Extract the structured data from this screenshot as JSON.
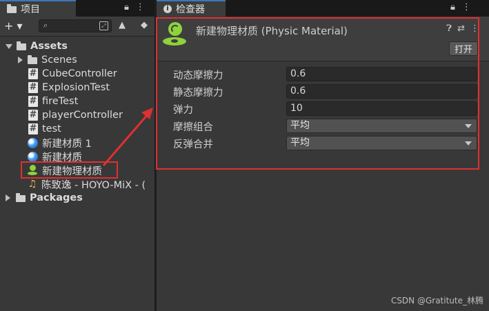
{
  "project_panel": {
    "tab_label": "项目",
    "toolbar": {
      "add_label": "+ ▾",
      "search_placeholder": ""
    },
    "tree": [
      {
        "label": "Assets",
        "type": "folder",
        "expanded": true
      },
      {
        "label": "Scenes",
        "type": "folder",
        "expanded": false
      },
      {
        "label": "CubeController",
        "type": "script"
      },
      {
        "label": "ExplosionTest",
        "type": "script"
      },
      {
        "label": "fireTest",
        "type": "script"
      },
      {
        "label": "playerController",
        "type": "script"
      },
      {
        "label": "test",
        "type": "script"
      },
      {
        "label": "新建材质 1",
        "type": "material"
      },
      {
        "label": "新建材质",
        "type": "material"
      },
      {
        "label": "新建物理材质",
        "type": "physic-material",
        "selected": true
      },
      {
        "label": "陈致逸 - HOYO-MiX - (",
        "type": "audio"
      },
      {
        "label": "Packages",
        "type": "folder",
        "expanded": false
      }
    ]
  },
  "inspector": {
    "tab_label": "检查器",
    "title": "新建物理材质 (Physic Material)",
    "open_button": "打开",
    "properties": [
      {
        "label": "动态摩擦力",
        "value": "0.6",
        "kind": "field"
      },
      {
        "label": "静态摩擦力",
        "value": "0.6",
        "kind": "field"
      },
      {
        "label": "弹力",
        "value": "10",
        "kind": "field"
      },
      {
        "label": "摩擦组合",
        "value": "平均",
        "kind": "dropdown"
      },
      {
        "label": "反弹合并",
        "value": "平均",
        "kind": "dropdown"
      }
    ]
  },
  "watermark": "CSDN @Gratitute_林腾",
  "colors": {
    "highlight": "#e03030",
    "accent_tab": "#3a79bb",
    "physic_icon": "#8ed23c"
  }
}
